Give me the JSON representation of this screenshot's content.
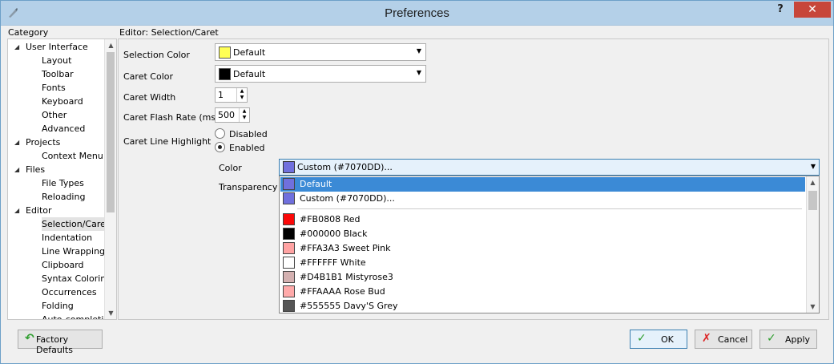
{
  "window": {
    "title": "Preferences",
    "help": "?",
    "close": "✕"
  },
  "category": {
    "label": "Category",
    "items": [
      {
        "label": "User Interface",
        "level": 0,
        "expanded": true
      },
      {
        "label": "Layout",
        "level": 1
      },
      {
        "label": "Toolbar",
        "level": 1
      },
      {
        "label": "Fonts",
        "level": 1
      },
      {
        "label": "Keyboard",
        "level": 1
      },
      {
        "label": "Other",
        "level": 1
      },
      {
        "label": "Advanced",
        "level": 1
      },
      {
        "label": "Projects",
        "level": 0,
        "expanded": true
      },
      {
        "label": "Context Menu",
        "level": 1
      },
      {
        "label": "Files",
        "level": 0,
        "expanded": true
      },
      {
        "label": "File Types",
        "level": 1
      },
      {
        "label": "Reloading",
        "level": 1
      },
      {
        "label": "Editor",
        "level": 0,
        "expanded": true
      },
      {
        "label": "Selection/Caret",
        "level": 1,
        "selected": true
      },
      {
        "label": "Indentation",
        "level": 1
      },
      {
        "label": "Line Wrapping",
        "level": 1
      },
      {
        "label": "Clipboard",
        "level": 1
      },
      {
        "label": "Syntax Coloring",
        "level": 1
      },
      {
        "label": "Occurrences",
        "level": 1
      },
      {
        "label": "Folding",
        "level": 1
      },
      {
        "label": "Auto-completion",
        "level": 1
      }
    ]
  },
  "editor": {
    "section_title": "Editor: Selection/Caret",
    "selection_color": {
      "label": "Selection Color",
      "value": "Default",
      "swatch": "#FFFF55"
    },
    "caret_color": {
      "label": "Caret Color",
      "value": "Default",
      "swatch": "#000000"
    },
    "caret_width": {
      "label": "Caret Width",
      "value": "1"
    },
    "caret_flash_rate": {
      "label": "Caret Flash Rate (ms)",
      "value": "500"
    },
    "caret_line_highlight": {
      "label": "Caret Line Highlight",
      "options": [
        "Disabled",
        "Enabled"
      ],
      "selected": "Enabled"
    },
    "color": {
      "label": "Color",
      "value": "Custom (#7070DD)...",
      "swatch": "#7070DD"
    },
    "transparency": {
      "label": "Transparency"
    }
  },
  "color_dropdown": {
    "items": [
      {
        "label": "Default",
        "swatch": "#7070DD",
        "highlighted": true
      },
      {
        "label": "Custom (#7070DD)...",
        "swatch": "#7070DD"
      },
      {
        "label": "#FB0808 Red",
        "swatch": "#FB0808"
      },
      {
        "label": "#000000 Black",
        "swatch": "#000000"
      },
      {
        "label": "#FFA3A3 Sweet Pink",
        "swatch": "#FFA3A3"
      },
      {
        "label": "#FFFFFF White",
        "swatch": "#FFFFFF"
      },
      {
        "label": "#D4B1B1 Mistyrose3",
        "swatch": "#D4B1B1"
      },
      {
        "label": "#FFAAAA Rose Bud",
        "swatch": "#FFAAAA"
      },
      {
        "label": "#555555 Davy'S Grey",
        "swatch": "#555555"
      }
    ]
  },
  "buttons": {
    "factory_defaults": "Factory Defaults",
    "ok": "OK",
    "cancel": "Cancel",
    "apply": "Apply"
  }
}
